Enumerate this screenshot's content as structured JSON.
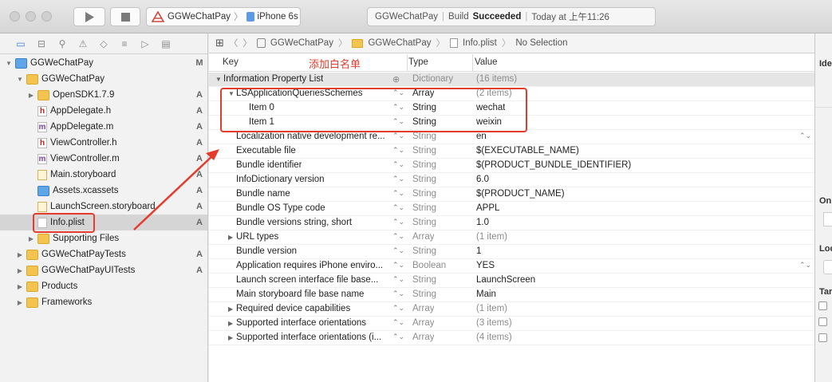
{
  "toolbar": {
    "scheme_project": "GGWeChatPay",
    "scheme_device": "iPhone 6s",
    "status_project": "GGWeChatPay",
    "status_build_prefix": "Build",
    "status_build_result": "Succeeded",
    "status_time": "Today at 上午11:26"
  },
  "navigator": {
    "rows": [
      {
        "name": "GGWeChatPay",
        "badge": "M",
        "indent": 0,
        "icon": "project",
        "disc": "▼"
      },
      {
        "name": "GGWeChatPay",
        "badge": "",
        "indent": 1,
        "icon": "folder",
        "disc": "▼"
      },
      {
        "name": "OpenSDK1.7.9",
        "badge": "A",
        "indent": 2,
        "icon": "folder",
        "disc": "▶"
      },
      {
        "name": "AppDelegate.h",
        "badge": "A",
        "indent": 2,
        "icon": "h",
        "disc": ""
      },
      {
        "name": "AppDelegate.m",
        "badge": "A",
        "indent": 2,
        "icon": "m",
        "disc": ""
      },
      {
        "name": "ViewController.h",
        "badge": "A",
        "indent": 2,
        "icon": "h",
        "disc": ""
      },
      {
        "name": "ViewController.m",
        "badge": "A",
        "indent": 2,
        "icon": "m",
        "disc": ""
      },
      {
        "name": "Main.storyboard",
        "badge": "A",
        "indent": 2,
        "icon": "sb",
        "disc": ""
      },
      {
        "name": "Assets.xcassets",
        "badge": "A",
        "indent": 2,
        "icon": "assets",
        "disc": ""
      },
      {
        "name": "LaunchScreen.storyboard",
        "badge": "A",
        "indent": 2,
        "icon": "sb",
        "disc": ""
      },
      {
        "name": "Info.plist",
        "badge": "A",
        "indent": 2,
        "icon": "plist",
        "disc": ""
      },
      {
        "name": "Supporting Files",
        "badge": "",
        "indent": 2,
        "icon": "folder",
        "disc": "▶"
      },
      {
        "name": "GGWeChatPayTests",
        "badge": "A",
        "indent": 1,
        "icon": "folder",
        "disc": "▶"
      },
      {
        "name": "GGWeChatPayUITests",
        "badge": "A",
        "indent": 1,
        "icon": "folder",
        "disc": "▶"
      },
      {
        "name": "Products",
        "badge": "",
        "indent": 1,
        "icon": "folder",
        "disc": "▶"
      },
      {
        "name": "Frameworks",
        "badge": "",
        "indent": 1,
        "icon": "folder",
        "disc": "▶"
      }
    ]
  },
  "jumpbar": {
    "crumbs": [
      "GGWeChatPay",
      "GGWeChatPay",
      "Info.plist",
      "No Selection"
    ]
  },
  "plist": {
    "col_key": "Key",
    "col_type": "Type",
    "col_value": "Value",
    "annotation": "添加白名单",
    "rows": [
      {
        "key": "Information Property List",
        "type": "Dictionary",
        "value": "(16 items)",
        "level": 0,
        "disc": "▼",
        "gray": true
      },
      {
        "key": "LSApplicationQueriesSchemes",
        "type": "Array",
        "value": "(2 items)",
        "level": 1,
        "disc": "▼",
        "gray": false
      },
      {
        "key": "Item 0",
        "type": "String",
        "value": "wechat",
        "level": 2,
        "disc": "",
        "gray": false
      },
      {
        "key": "Item 1",
        "type": "String",
        "value": "weixin",
        "level": 2,
        "disc": "",
        "gray": false
      },
      {
        "key": "Localization native development re...",
        "type": "String",
        "value": "en",
        "level": 1,
        "disc": "",
        "gray": true
      },
      {
        "key": "Executable file",
        "type": "String",
        "value": "$(EXECUTABLE_NAME)",
        "level": 1,
        "disc": "",
        "gray": true
      },
      {
        "key": "Bundle identifier",
        "type": "String",
        "value": "$(PRODUCT_BUNDLE_IDENTIFIER)",
        "level": 1,
        "disc": "",
        "gray": true
      },
      {
        "key": "InfoDictionary version",
        "type": "String",
        "value": "6.0",
        "level": 1,
        "disc": "",
        "gray": true
      },
      {
        "key": "Bundle name",
        "type": "String",
        "value": "$(PRODUCT_NAME)",
        "level": 1,
        "disc": "",
        "gray": true
      },
      {
        "key": "Bundle OS Type code",
        "type": "String",
        "value": "APPL",
        "level": 1,
        "disc": "",
        "gray": true
      },
      {
        "key": "Bundle versions string, short",
        "type": "String",
        "value": "1.0",
        "level": 1,
        "disc": "",
        "gray": true
      },
      {
        "key": "URL types",
        "type": "Array",
        "value": "(1 item)",
        "level": 1,
        "disc": "▶",
        "gray": true
      },
      {
        "key": "Bundle version",
        "type": "String",
        "value": "1",
        "level": 1,
        "disc": "",
        "gray": true
      },
      {
        "key": "Application requires iPhone enviro...",
        "type": "Boolean",
        "value": "YES",
        "level": 1,
        "disc": "",
        "gray": true
      },
      {
        "key": "Launch screen interface file base...",
        "type": "String",
        "value": "LaunchScreen",
        "level": 1,
        "disc": "",
        "gray": true
      },
      {
        "key": "Main storyboard file base name",
        "type": "String",
        "value": "Main",
        "level": 1,
        "disc": "",
        "gray": true
      },
      {
        "key": "Required device capabilities",
        "type": "Array",
        "value": "(1 item)",
        "level": 1,
        "disc": "▶",
        "gray": true
      },
      {
        "key": "Supported interface orientations",
        "type": "Array",
        "value": "(3 items)",
        "level": 1,
        "disc": "▶",
        "gray": true
      },
      {
        "key": "Supported interface orientations (i...",
        "type": "Array",
        "value": "(4 items)",
        "level": 1,
        "disc": "▶",
        "gray": true
      }
    ]
  },
  "inspector": {
    "labels": [
      "Ide",
      "On",
      "Loc",
      "Tar"
    ]
  },
  "colors": {
    "annotation_red": "#e53b2c",
    "selection": "#d5d5d5"
  }
}
